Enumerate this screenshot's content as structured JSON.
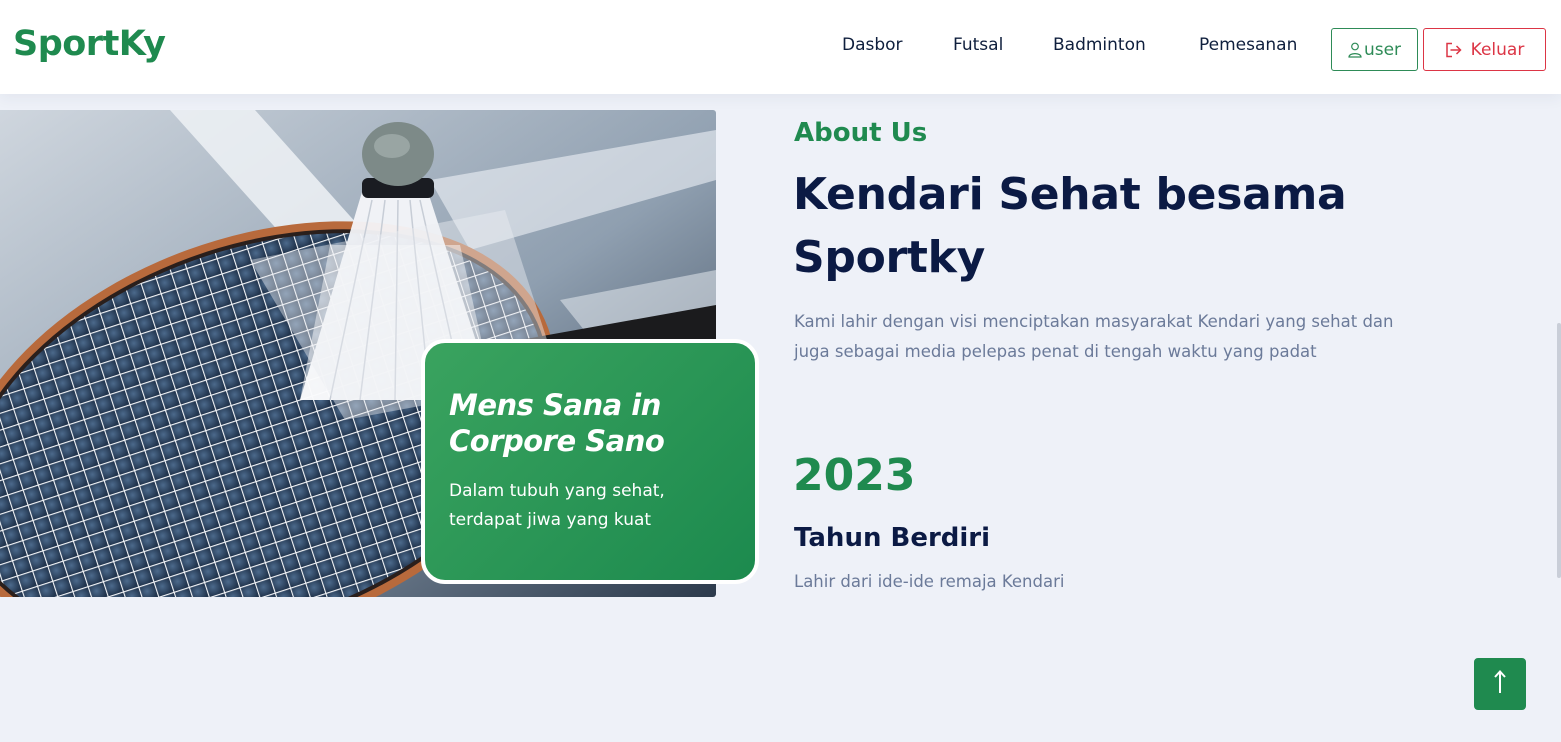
{
  "brand": {
    "name": "SportKy",
    "color": "#1f8a4f"
  },
  "nav": {
    "items": [
      {
        "label": "Dasbor"
      },
      {
        "label": "Futsal"
      },
      {
        "label": "Badminton"
      },
      {
        "label": "Pemesanan"
      }
    ],
    "user_button": {
      "label": "user",
      "icon": "user-icon"
    },
    "logout_button": {
      "label": "Keluar",
      "icon": "logout-icon"
    }
  },
  "hero": {
    "image_subject": "badminton racket and shuttlecock",
    "card": {
      "title": "Mens Sana in Corpore Sano",
      "subtitle": "Dalam tubuh yang sehat, terdapat jiwa yang kuat"
    }
  },
  "about": {
    "label": "About Us",
    "heading": "Kendari Sehat besama Sportky",
    "description": "Kami lahir dengan visi menciptakan masyarakat Kendari yang sehat dan juga sebagai media pelepas penat di tengah waktu yang padat",
    "stat": {
      "value": "2023",
      "title": "Tahun Berdiri",
      "description": "Lahir dari ide-ide remaja Kendari"
    }
  },
  "back_to_top": {
    "icon": "arrow-up-icon"
  },
  "colors": {
    "accent": "#1f8a4f",
    "danger": "#dc3545",
    "heading": "#0b1a44",
    "muted": "#6b7a99",
    "background": "#eef1f8"
  }
}
